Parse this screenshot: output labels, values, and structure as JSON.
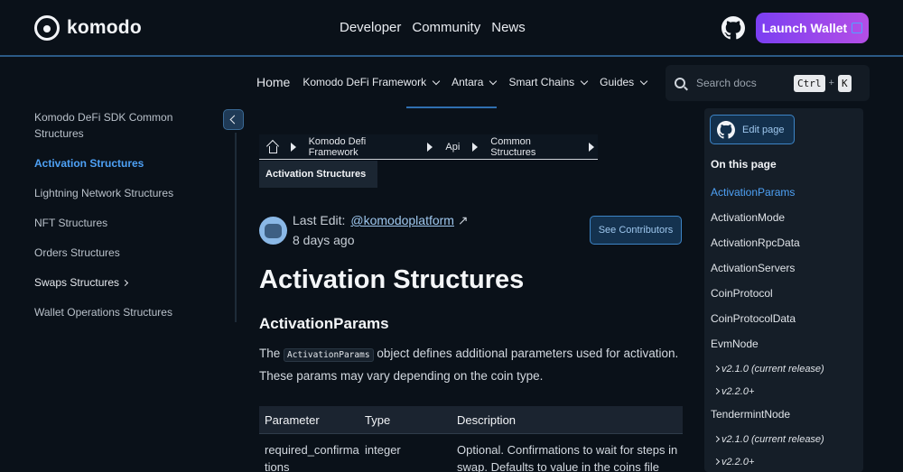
{
  "brand": {
    "name": "komodo"
  },
  "topnav": {
    "items": [
      "Developer",
      "Community",
      "News"
    ],
    "launch_label": "Launch Wallet"
  },
  "subnav": {
    "home": "Home",
    "items": [
      "Komodo DeFi Framework",
      "Antara",
      "Smart Chains",
      "Guides"
    ]
  },
  "search": {
    "placeholder": "Search docs",
    "key1": "Ctrl",
    "plus": "+",
    "key2": "K"
  },
  "sidebar": {
    "items": [
      "Komodo DeFi SDK Common Structures",
      "Activation Structures",
      "Lightning Network Structures",
      "NFT Structures",
      "Orders Structures",
      "Swaps Structures",
      "Wallet Operations Structures"
    ]
  },
  "breadcrumb": {
    "items": [
      "Komodo Defi Framework",
      "Api",
      "Common Structures"
    ],
    "current": "Activation Structures"
  },
  "meta": {
    "last_edit_label": "Last Edit:",
    "user": "@komodoplatform",
    "arrow": "↗",
    "ago": "8 days ago",
    "contributors_label": "See Contributors"
  },
  "content": {
    "title": "Activation Structures",
    "section": "ActivationParams",
    "para_pre": "The",
    "para_code": "ActivationParams",
    "para_post": "object defines additional parameters used for activation. These params may vary depending on the coin type.",
    "table": {
      "headers": [
        "Parameter",
        "Type",
        "Description"
      ],
      "rows": [
        [
          "required_confirmations",
          "integer",
          "Optional. Confirmations to wait for steps in swap. Defaults to value in the coins file"
        ]
      ]
    }
  },
  "toc": {
    "edit_label": "Edit page",
    "title": "On this page",
    "items": [
      "ActivationParams",
      "ActivationMode",
      "ActivationRpcData",
      "ActivationServers",
      "CoinProtocol",
      "CoinProtocolData",
      "EvmNode",
      "v2.1.0 (current release)",
      "v2.2.0+",
      "TendermintNode",
      "v2.1.0 (current release)",
      "v2.2.0+"
    ]
  },
  "colors": {
    "accent": "#4ea1f5",
    "background": "#0a1119",
    "launch_gradient_start": "#7b3ff2",
    "launch_gradient_end": "#b44ee6"
  }
}
